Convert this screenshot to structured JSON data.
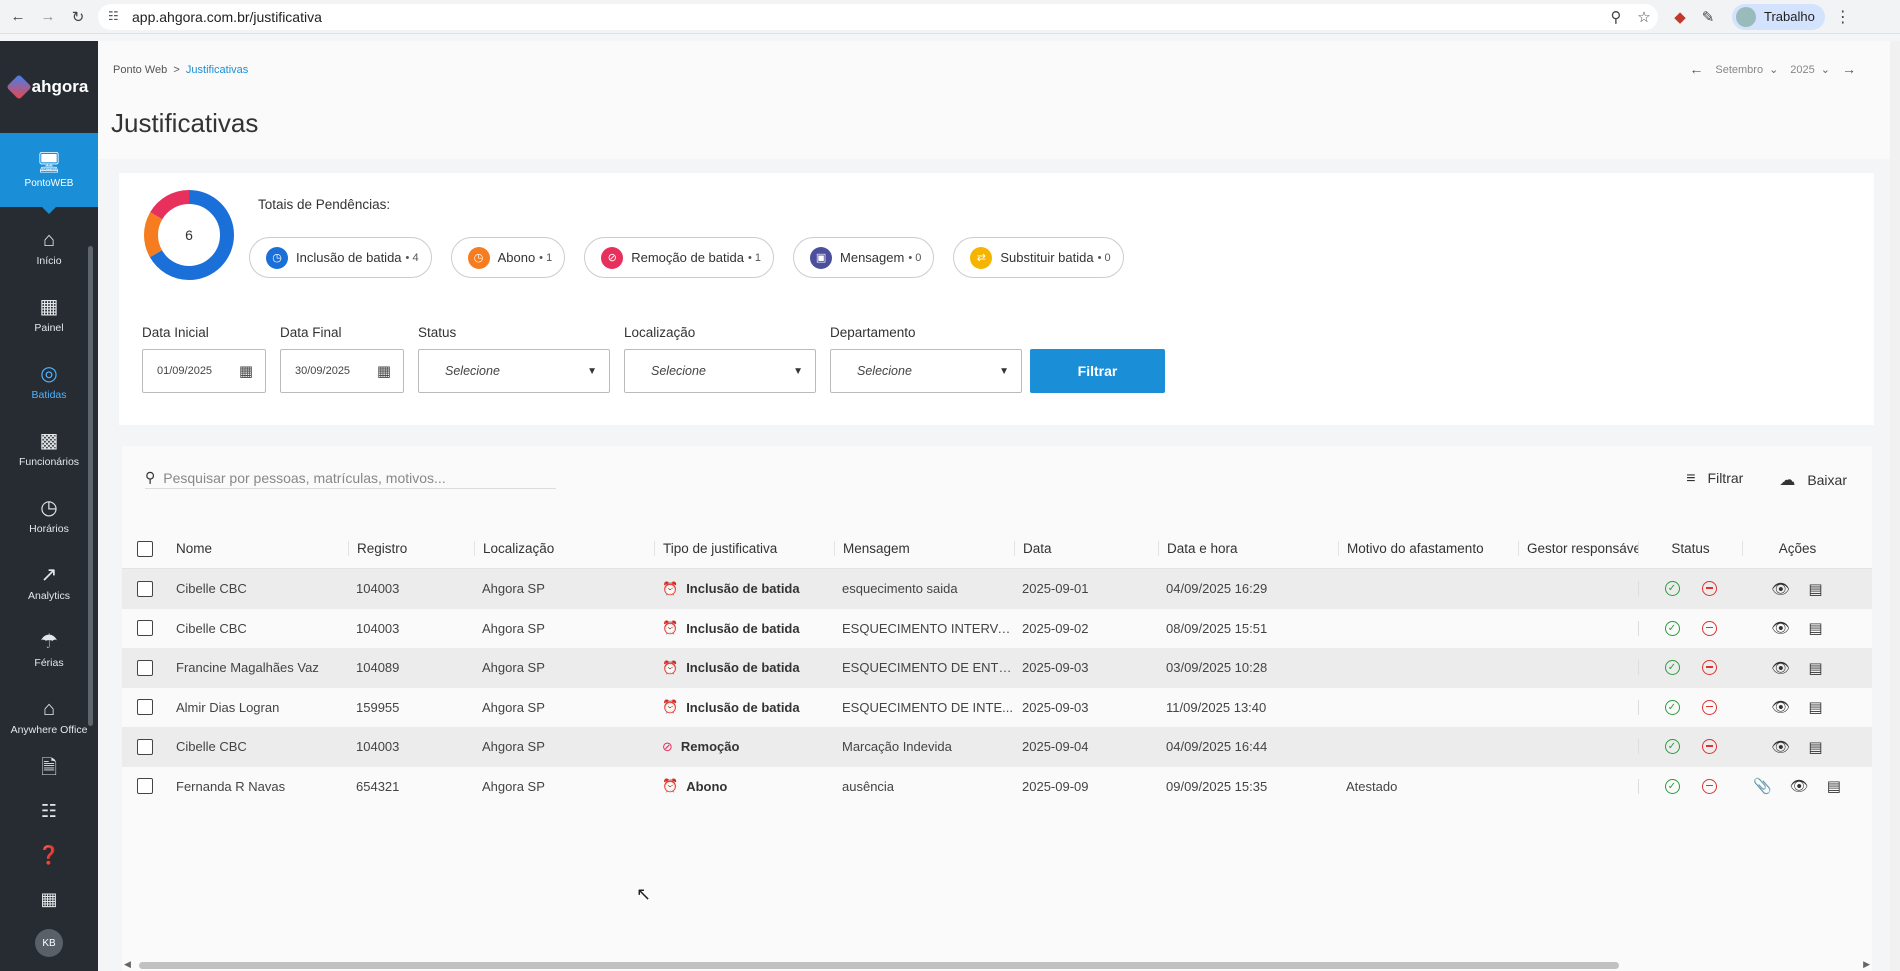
{
  "browser": {
    "url": "app.ahgora.com.br/justificativa",
    "profile_label": "Trabalho"
  },
  "sidebar": {
    "logo": "ahgora",
    "active": {
      "label": "PontoWEB",
      "icon": "monitor-icon"
    },
    "items": [
      {
        "label": "Início",
        "icon": "home-icon"
      },
      {
        "label": "Painel",
        "icon": "dashboard-icon"
      },
      {
        "label": "Batidas",
        "icon": "fingerprint-icon"
      },
      {
        "label": "Funcionários",
        "icon": "badge-icon"
      },
      {
        "label": "Horários",
        "icon": "clock-icon"
      },
      {
        "label": "Analytics",
        "icon": "trending-icon"
      },
      {
        "label": "Férias",
        "icon": "beach-icon"
      },
      {
        "label": "Anywhere Office",
        "icon": "house-work-icon"
      }
    ],
    "avatar_initials": "KB"
  },
  "header": {
    "breadcrumb": [
      "Ponto Web",
      "Justificativas"
    ],
    "title": "Justificativas",
    "month": "Setembro",
    "year": "2025"
  },
  "summary": {
    "total": "6",
    "totals_label": "Totais de Pendências:",
    "pills": [
      {
        "label": "Inclusão de batida",
        "count": "4",
        "color": "#1a6fd8"
      },
      {
        "label": "Abono",
        "count": "1",
        "color": "#f57c1f"
      },
      {
        "label": "Remoção de batida",
        "count": "1",
        "color": "#e8305c"
      },
      {
        "label": "Mensagem",
        "count": "0",
        "color": "#4b4f9c"
      },
      {
        "label": "Substituir batida",
        "count": "0",
        "color": "#f5b400"
      }
    ]
  },
  "filters": {
    "data_inicial_label": "Data Inicial",
    "data_inicial": "01/09/2025",
    "data_final_label": "Data Final",
    "data_final": "30/09/2025",
    "status_label": "Status",
    "status_value": "Selecione",
    "localizacao_label": "Localização",
    "localizacao_value": "Selecione",
    "departamento_label": "Departamento",
    "departamento_value": "Selecione",
    "button": "Filtrar"
  },
  "table": {
    "search_placeholder": "Pesquisar por pessoas, matrículas, motivos...",
    "filter_label": "Filtrar",
    "download_label": "Baixar",
    "columns": [
      "Nome",
      "Registro",
      "Localização",
      "Tipo de justificativa",
      "Mensagem",
      "Data",
      "Data e hora",
      "Motivo do afastamento",
      "Gestor responsáve",
      "Status",
      "Ações"
    ],
    "rows": [
      {
        "nome": "Cibelle CBC",
        "registro": "104003",
        "localizacao": "Ahgora SP",
        "tipo": "Inclusão de batida",
        "tipo_icon": "alarm-add-icon",
        "tipo_color": "#1a6fd8",
        "mensagem": "esquecimento saida",
        "data": "2025-09-01",
        "data_hora": "04/09/2025 16:29",
        "motivo": ""
      },
      {
        "nome": "Cibelle CBC",
        "registro": "104003",
        "localizacao": "Ahgora SP",
        "tipo": "Inclusão de batida",
        "tipo_icon": "alarm-add-icon",
        "tipo_color": "#1a6fd8",
        "mensagem": "ESQUECIMENTO INTERVA...",
        "data": "2025-09-02",
        "data_hora": "08/09/2025 15:51",
        "motivo": ""
      },
      {
        "nome": "Francine Magalhães Vaz",
        "registro": "104089",
        "localizacao": "Ahgora SP",
        "tipo": "Inclusão de batida",
        "tipo_icon": "alarm-add-icon",
        "tipo_color": "#1a6fd8",
        "mensagem": "ESQUECIMENTO DE ENTR...",
        "data": "2025-09-03",
        "data_hora": "03/09/2025 10:28",
        "motivo": ""
      },
      {
        "nome": "Almir Dias Logran",
        "registro": "159955",
        "localizacao": "Ahgora SP",
        "tipo": "Inclusão de batida",
        "tipo_icon": "alarm-add-icon",
        "tipo_color": "#1a6fd8",
        "mensagem": "ESQUECIMENTO DE INTE...",
        "data": "2025-09-03",
        "data_hora": "11/09/2025 13:40",
        "motivo": ""
      },
      {
        "nome": "Cibelle CBC",
        "registro": "104003",
        "localizacao": "Ahgora SP",
        "tipo": "Remoção",
        "tipo_icon": "alarm-off-icon",
        "tipo_color": "#e8305c",
        "mensagem": "Marcação Indevida",
        "data": "2025-09-04",
        "data_hora": "04/09/2025 16:44",
        "motivo": ""
      },
      {
        "nome": "Fernanda R Navas",
        "registro": "654321",
        "localizacao": "Ahgora SP",
        "tipo": "Abono",
        "tipo_icon": "alarm-check-icon",
        "tipo_color": "#f57c1f",
        "mensagem": "ausência",
        "data": "2025-09-09",
        "data_hora": "09/09/2025 15:35",
        "motivo": "Atestado",
        "has_attachment": true
      }
    ]
  }
}
